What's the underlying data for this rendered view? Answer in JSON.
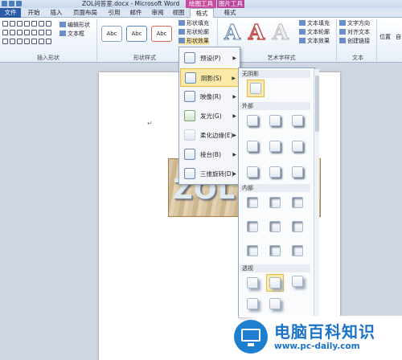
{
  "window": {
    "title": "ZOL问答室.docx - Microsoft Word",
    "context_draw": "绘图工具",
    "context_pic": "图片工具"
  },
  "tabs": [
    "文件",
    "开始",
    "插入",
    "页面布局",
    "引用",
    "邮件",
    "审阅",
    "视图",
    "格式",
    "格式"
  ],
  "ribbon": {
    "insert_shapes": {
      "label": "插入形状",
      "edit_shape": "编辑形状",
      "textbox": "文本框"
    },
    "shape_styles": {
      "label": "形状样式",
      "abc": [
        "Abc",
        "Abc",
        "Abc"
      ],
      "fill": "形状填充",
      "outline": "形状轮廓",
      "effects": "形状效果"
    },
    "wordart": {
      "label": "艺术字样式",
      "letters": [
        "A",
        "A",
        "A"
      ],
      "text_fill": "文本填充",
      "text_outline": "文本轮廓",
      "text_effects": "文本效果"
    },
    "text": {
      "label": "文本",
      "direction": "文字方向",
      "align": "对齐文本",
      "link": "创建链接"
    },
    "arrange": {
      "position": "位置",
      "wrap": "自"
    }
  },
  "document": {
    "wordart": "ZOL",
    "para_mark": "↵"
  },
  "effects_menu": {
    "items": [
      "预设(P)",
      "阴影(S)",
      "映像(R)",
      "发光(G)",
      "柔化边缘(E)",
      "棱台(B)",
      "三维旋转(D)"
    ],
    "active_index": 1
  },
  "shadow_submenu": {
    "headers": {
      "none": "无阴影",
      "outer": "外部",
      "inner": "内部",
      "perspective": "透视"
    }
  },
  "watermark": {
    "title": "电脑百科知识",
    "url": "www.pc-daily.com"
  },
  "colors": {
    "file_tab": "#2a5ca8",
    "draw_tools": "#c94a9e",
    "highlight": "#fde9a7",
    "brand": "#1a73c9"
  }
}
